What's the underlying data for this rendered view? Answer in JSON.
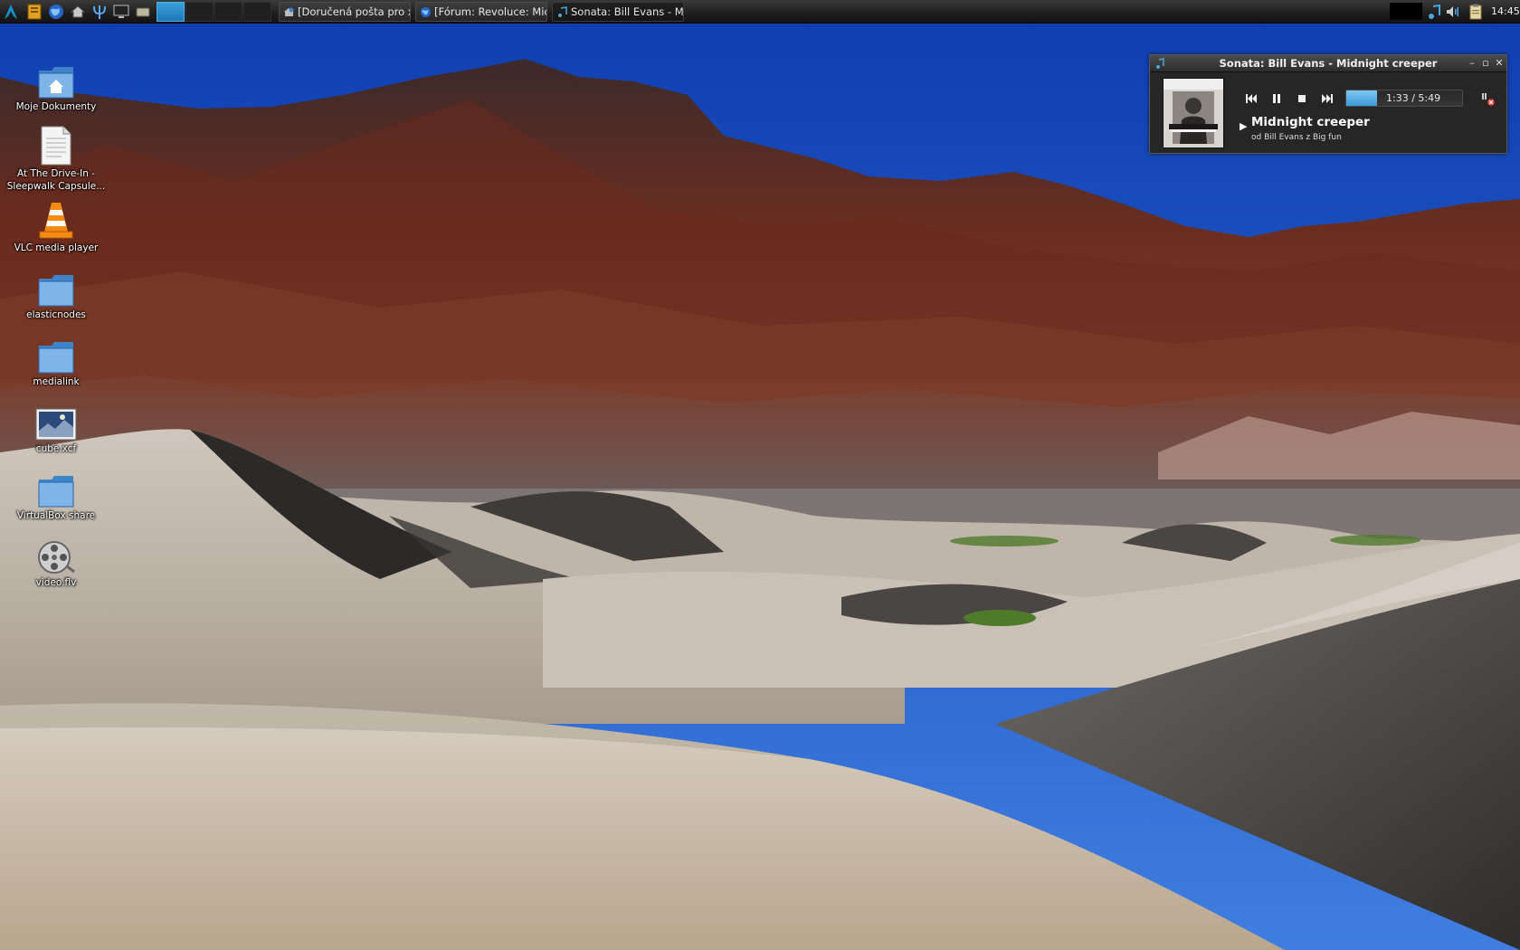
{
  "taskbar": {
    "tasks": [
      {
        "label": "[Doručená pošta pro xm..."
      },
      {
        "label": "[Fórum: Revoluce: Micro..."
      },
      {
        "label": "Sonata: Bill Evans - Mid..."
      }
    ],
    "clock": "14:45"
  },
  "desktop": {
    "icons": [
      {
        "label": "Moje Dokumenty",
        "icon": "home-folder-icon"
      },
      {
        "label": "At The Drive-In - Sleepwalk Capsule...",
        "icon": "text-file-icon"
      },
      {
        "label": "VLC media player",
        "icon": "vlc-cone-icon"
      },
      {
        "label": "elasticnodes",
        "icon": "folder-icon"
      },
      {
        "label": "medialink",
        "icon": "folder-icon"
      },
      {
        "label": "cube.xcf",
        "icon": "image-file-icon"
      },
      {
        "label": "VirtualBox share",
        "icon": "folder-icon"
      },
      {
        "label": "video.flv",
        "icon": "film-reel-icon"
      }
    ]
  },
  "player": {
    "window_title": "Sonata: Bill Evans - Midnight creeper",
    "time": "1:33 / 5:49",
    "progress_fraction": 0.266,
    "song_title": "Midnight creeper",
    "song_subtitle": "od Bill Evans z Big fun",
    "accent": "#3c98d4"
  }
}
